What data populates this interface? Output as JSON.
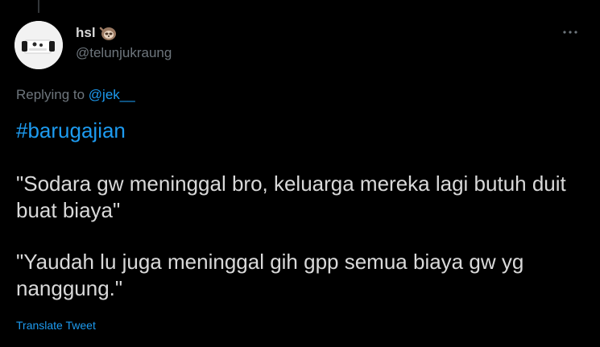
{
  "author": {
    "display_name": "hsl",
    "handle": "@telunjukraung",
    "emoji_icon": "sloth-emoji-icon"
  },
  "more_icon": "more-options-icon",
  "reply_context": {
    "prefix": "Replying to ",
    "mention": "@jek__"
  },
  "tweet": {
    "hashtag": "#barugajian",
    "paragraph_1": "\"Sodara gw meninggal bro, keluarga mereka lagi butuh duit buat biaya\"",
    "paragraph_2": "\"Yaudah lu juga meninggal gih gpp semua biaya gw yg nanggung.\""
  },
  "translate_label": "Translate Tweet",
  "colors": {
    "background": "#000000",
    "text": "#d9d9d9",
    "secondary": "#6e767d",
    "accent": "#1d9bf0"
  }
}
